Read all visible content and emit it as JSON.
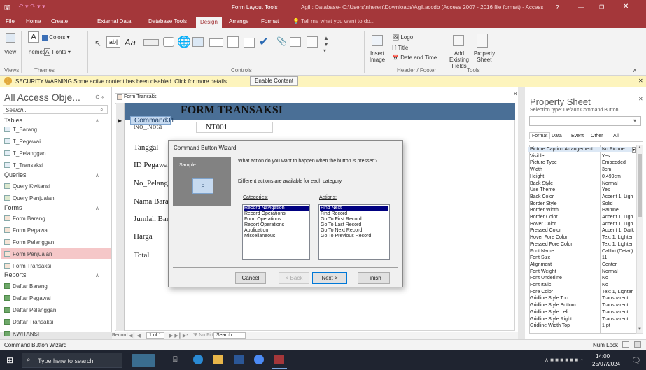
{
  "window": {
    "context_title": "Form Layout Tools",
    "title": "Agil : Database- C:\\Users\\nheren\\Downloads\\Agil.accdb (Access 2007 - 2016 file format) - Access",
    "help": "?"
  },
  "tabs": [
    "File",
    "Home",
    "Create",
    "External Data",
    "Database Tools",
    "Design",
    "Arrange",
    "Format"
  ],
  "tell_me": "Tell me what you want to do...",
  "ribbon": {
    "view": "View",
    "themes": "Themes",
    "colors": "Colors",
    "fonts": "Fonts",
    "views_group": "Views",
    "themes_group": "Themes",
    "controls_group": "Controls",
    "header_footer_group": "Header / Footer",
    "tools_group": "Tools",
    "insert_image": "Insert Image",
    "logo": "Logo",
    "title": "Title",
    "date_time": "Date and Time",
    "add_existing_fields": "Add Existing Fields",
    "property_sheet": "Property Sheet"
  },
  "security": {
    "text": "SECURITY WARNING  Some active content has been disabled. Click for more details.",
    "button": "Enable Content"
  },
  "nav": {
    "title": "All Access Obje...",
    "search_placeholder": "Search...",
    "sections": [
      {
        "label": "Tables",
        "items": [
          "T_Barang",
          "T_Pegawai",
          "T_Pelanggan",
          "T_Transaksi"
        ]
      },
      {
        "label": "Queries",
        "items": [
          "Query Kwitansi",
          "Query Penjualan"
        ]
      },
      {
        "label": "Forms",
        "items": [
          "Form Barang",
          "Form Pegawai",
          "Form Pelanggan",
          "Form Penjualan",
          "Form Transaksi"
        ]
      },
      {
        "label": "Reports",
        "items": [
          "Daftar Barang",
          "Daftar Pegawai",
          "Daftar Pelanggan",
          "Daftar Transaksi",
          "KWITANSI"
        ]
      }
    ],
    "selected": "Form Penjualan"
  },
  "doc": {
    "tab": "Form Transaksi",
    "form_title": "FORM TRANSAKSI",
    "command_button": "Command31",
    "no_nota_value": "NT001",
    "labels": [
      "No_Nota",
      "Tanggal",
      "ID Pegawai",
      "No_Pelangg",
      "Nama Barar",
      "Jumlah Bara",
      "Harga",
      "Total"
    ]
  },
  "wizard": {
    "title": "Command Button Wizard",
    "sample_label": "Sample:",
    "question": "What action do you want to happen when the button is pressed?",
    "info": "Different actions are available for each category.",
    "categories_label": "Categories:",
    "actions_label": "Actions:",
    "categories": [
      "Record Navigation",
      "Record Operations",
      "Form Operations",
      "Report Operations",
      "Application",
      "Miscellaneous"
    ],
    "actions": [
      "Find Next",
      "Find Record",
      "Go To First Record",
      "Go To Last Record",
      "Go To Next Record",
      "Go To Previous Record"
    ],
    "selected_category": "Record Navigation",
    "selected_action": "Find Next",
    "cancel": "Cancel",
    "back": "< Back",
    "next": "Next >",
    "finish": "Finish"
  },
  "record_nav": {
    "label": "Record:",
    "position": "1 of 1",
    "filter": "No Filter",
    "search": "Search"
  },
  "property_sheet": {
    "title": "Property Sheet",
    "selection_type": "Selection type:  Default Command Button",
    "tabs": [
      "Format",
      "Data",
      "Event",
      "Other",
      "All"
    ],
    "rows": [
      [
        "Picture Caption Arrangement",
        "No Picture"
      ],
      [
        "Visible",
        "Yes"
      ],
      [
        "Picture Type",
        "Embedded"
      ],
      [
        "Width",
        "3cm"
      ],
      [
        "Height",
        "0,499cm"
      ],
      [
        "Back Style",
        "Normal"
      ],
      [
        "Use Theme",
        "Yes"
      ],
      [
        "Back Color",
        "Accent 1, Ligh"
      ],
      [
        "Border Style",
        "Solid"
      ],
      [
        "Border Width",
        "Hairline"
      ],
      [
        "Border Color",
        "Accent 1, Ligh"
      ],
      [
        "Hover Color",
        "Accent 1, Ligh"
      ],
      [
        "Pressed Color",
        "Accent 1, Dark"
      ],
      [
        "Hover Fore Color",
        "Text 1, Lighter"
      ],
      [
        "Pressed Fore Color",
        "Text 1, Lighter"
      ],
      [
        "Font Name",
        "Calibri (Detail)"
      ],
      [
        "Font Size",
        "11"
      ],
      [
        "Alignment",
        "Center"
      ],
      [
        "Font Weight",
        "Normal"
      ],
      [
        "Font Underline",
        "No"
      ],
      [
        "Font Italic",
        "No"
      ],
      [
        "Fore Color",
        "Text 1, Lighter"
      ],
      [
        "Gridline Style Top",
        "Transparent"
      ],
      [
        "Gridline Style Bottom",
        "Transparent"
      ],
      [
        "Gridline Style Left",
        "Transparent"
      ],
      [
        "Gridline Style Right",
        "Transparent"
      ],
      [
        "Gridline Width Top",
        "1 pt"
      ]
    ]
  },
  "statusbar": {
    "left": "Command Button Wizard",
    "num_lock": "Num Lock"
  },
  "taskbar": {
    "search": "Type here to search",
    "time": "14:00",
    "date": "25/07/2024"
  },
  "colors": {
    "accent": "#a4373a",
    "selection": "#000080"
  }
}
